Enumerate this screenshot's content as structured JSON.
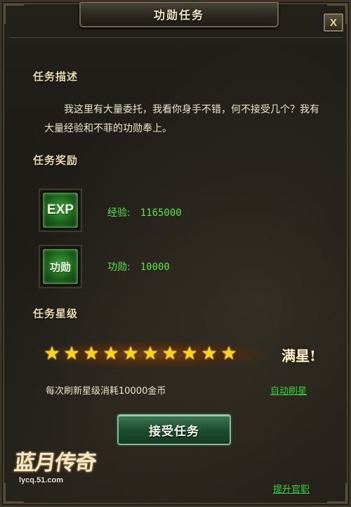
{
  "window": {
    "title": "功勋任务",
    "close_label": "X"
  },
  "description": {
    "heading": "任务描述",
    "text": "我这里有大量委托，我看你身手不错，何不接受几个？我有大量经验和不菲的功勋奉上。"
  },
  "rewards": {
    "heading": "任务奖励",
    "items": [
      {
        "icon_text": "EXP",
        "icon": "exp-icon",
        "label": "经验:",
        "value": "1165000"
      },
      {
        "icon_text": "功勋",
        "icon": "merit-icon",
        "label": "功勋:",
        "value": "10000"
      }
    ]
  },
  "star_level": {
    "heading": "任务星级",
    "stars_filled": 10,
    "stars_total": 10,
    "full_label": "满星!",
    "refresh_cost": "每次刷新星级消耗10000金币",
    "auto_refresh_link": "自动刷星"
  },
  "accept_button": "接受任务",
  "promote_link": "提升官职",
  "logo": {
    "title": "蓝月传奇",
    "url": "lycq.51.com"
  },
  "colors": {
    "reward_green": "#5fe14f",
    "link_green": "#39d33a",
    "star_gold": "#ffd21e",
    "title_text": "#e8d9b0"
  }
}
